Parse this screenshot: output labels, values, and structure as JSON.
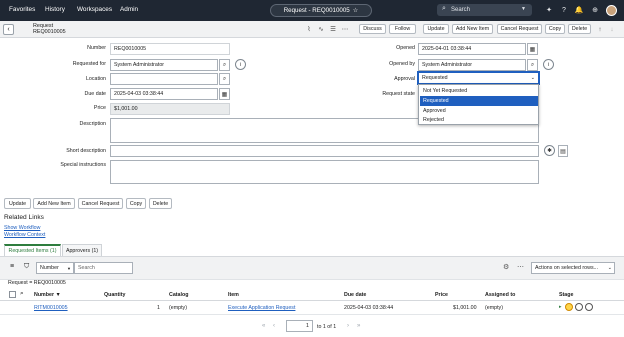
{
  "nav": {
    "menu": [
      "Favorites",
      "History",
      "Workspaces",
      "Admin"
    ],
    "record_title": "Request - REQ0010005",
    "search_placeholder": "Search",
    "colors": {
      "bar": "#1f2733",
      "accent": "#1f5fbf",
      "active_tab": "#2e7d3e"
    }
  },
  "header": {
    "type": "Request",
    "number": "REQ0010005",
    "buttons": [
      "Discuss",
      "Follow",
      "Update",
      "Add New Item",
      "Cancel Request",
      "Copy",
      "Delete"
    ]
  },
  "form": {
    "number": {
      "label": "Number",
      "value": "REQ0010005"
    },
    "requested_for": {
      "label": "Requested for",
      "value": "System Administrator"
    },
    "location": {
      "label": "Location",
      "value": ""
    },
    "due_date": {
      "label": "Due date",
      "value": "2025-04-03 03:38:44"
    },
    "price": {
      "label": "Price",
      "value": "$1,001.00"
    },
    "description": {
      "label": "Description",
      "value": ""
    },
    "short_description": {
      "label": "Short description",
      "value": ""
    },
    "special_instructions": {
      "label": "Special instructions",
      "value": ""
    },
    "opened": {
      "label": "Opened",
      "value": "2025-04-01 03:38:44"
    },
    "opened_by": {
      "label": "Opened by",
      "value": "System Administrator"
    },
    "approval": {
      "label": "Approval",
      "value": "Requested",
      "options": [
        "Not Yet Requested",
        "Requested",
        "Approved",
        "Rejected"
      ],
      "selected_index": 1
    },
    "request_state": {
      "label": "Request state"
    }
  },
  "bottom_buttons": [
    "Update",
    "Add New Item",
    "Cancel Request",
    "Copy",
    "Delete"
  ],
  "related": {
    "title": "Related Links",
    "links": [
      "Show Workflow",
      "Workflow Context"
    ],
    "tabs": [
      "Requested Items (1)",
      "Approvers (1)"
    ]
  },
  "list": {
    "filter_field": "Number",
    "search_placeholder": "Search",
    "actions_placeholder": "Actions on selected rows...",
    "breadcrumb": "Request = REQ0010005",
    "columns": [
      "Number",
      "Quantity",
      "Catalog",
      "Item",
      "Due date",
      "Price",
      "Assigned to",
      "Stage"
    ],
    "sort_indicator": "▼",
    "rows": [
      {
        "number": "RITM0010005",
        "quantity": "1",
        "catalog": "(empty)",
        "item": "Execute Application Request",
        "due_date": "2025-04-03 03:38:44",
        "price": "$1,001.00",
        "assigned_to": "(empty)"
      }
    ],
    "pagination": {
      "current": "1",
      "of_text": "to 1 of 1"
    }
  }
}
